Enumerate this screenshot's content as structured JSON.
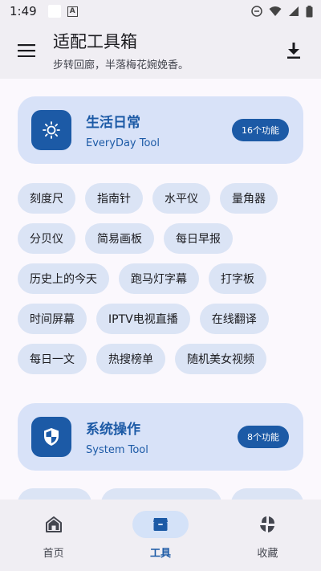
{
  "status": {
    "time": "1:49"
  },
  "app_bar": {
    "title": "适配工具箱",
    "subtitle": "步转回廊，半落梅花婉娩香。"
  },
  "categories": [
    {
      "title": "生活日常",
      "subtitle": "EveryDay Tool",
      "badge": "16个功能",
      "icon": "sun-gear-icon",
      "tools": [
        [
          "刻度尺",
          "指南针",
          "水平仪",
          "量角器"
        ],
        [
          "分贝仪",
          "简易画板",
          "每日早报"
        ],
        [
          "历史上的今天",
          "跑马灯字幕",
          "打字板"
        ],
        [
          "时间屏幕",
          "IPTV电视直播",
          "在线翻译"
        ],
        [
          "每日一文",
          "热搜榜单",
          "随机美女视频"
        ]
      ]
    },
    {
      "title": "系统操作",
      "subtitle": "System Tool",
      "badge": "8个功能",
      "icon": "shield-icon"
    }
  ],
  "nav": {
    "items": [
      {
        "label": "首页",
        "icon": "home-icon"
      },
      {
        "label": "工具",
        "icon": "toolbox-icon"
      },
      {
        "label": "收藏",
        "icon": "collection-icon"
      }
    ]
  },
  "colors": {
    "primary": "#1c5aa6",
    "card_bg": "#d8e2f8",
    "chip_bg": "#dbe4f5",
    "bar_bg": "#f0eef3"
  }
}
